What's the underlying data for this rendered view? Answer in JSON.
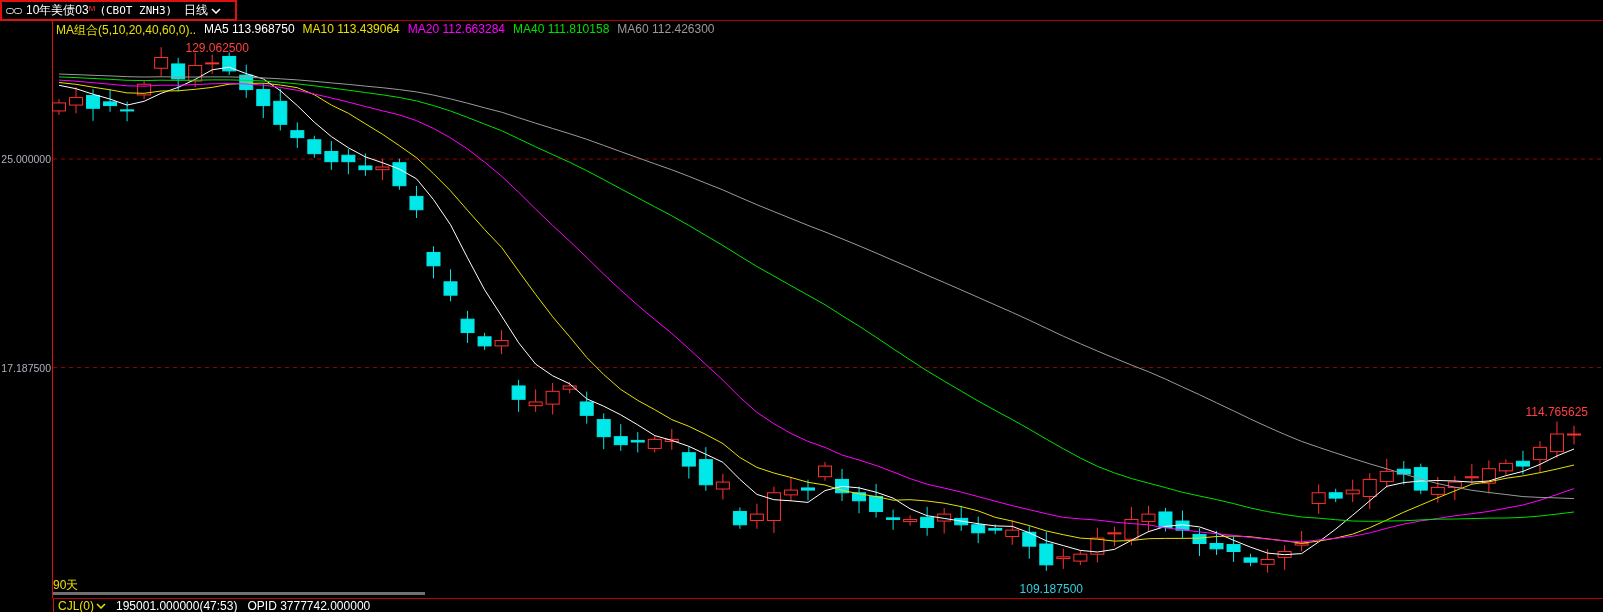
{
  "header": {
    "title": "10年美债03",
    "superscript": "M",
    "code": "(CBOT ZNH3)",
    "period": "日线"
  },
  "legend": {
    "group": "MA组合(5,10,20,40,60,0)..",
    "items": [
      {
        "label": "MA5",
        "value": "113.968750",
        "color": "#ffffff"
      },
      {
        "label": "MA10",
        "value": "113.439064",
        "color": "#e8e000"
      },
      {
        "label": "MA20",
        "value": "112.663284",
        "color": "#ff00ff"
      },
      {
        "label": "MA40",
        "value": "111.810158",
        "color": "#00e000"
      },
      {
        "label": "MA60",
        "value": "112.426300",
        "color": "#9a9a9a"
      }
    ]
  },
  "y_axis_labels": [
    "25.000000",
    "17.187500"
  ],
  "price_labels": [
    {
      "text": "129.062500",
      "kind": "high"
    },
    {
      "text": "109.187500",
      "kind": "low"
    },
    {
      "text": "114.765625",
      "kind": "last"
    }
  ],
  "range_label": "90天",
  "status": {
    "indicator": "CJL(0)",
    "volume": "195001.000000(47:53)",
    "open_interest": "OPID 3777742.000000"
  }
}
